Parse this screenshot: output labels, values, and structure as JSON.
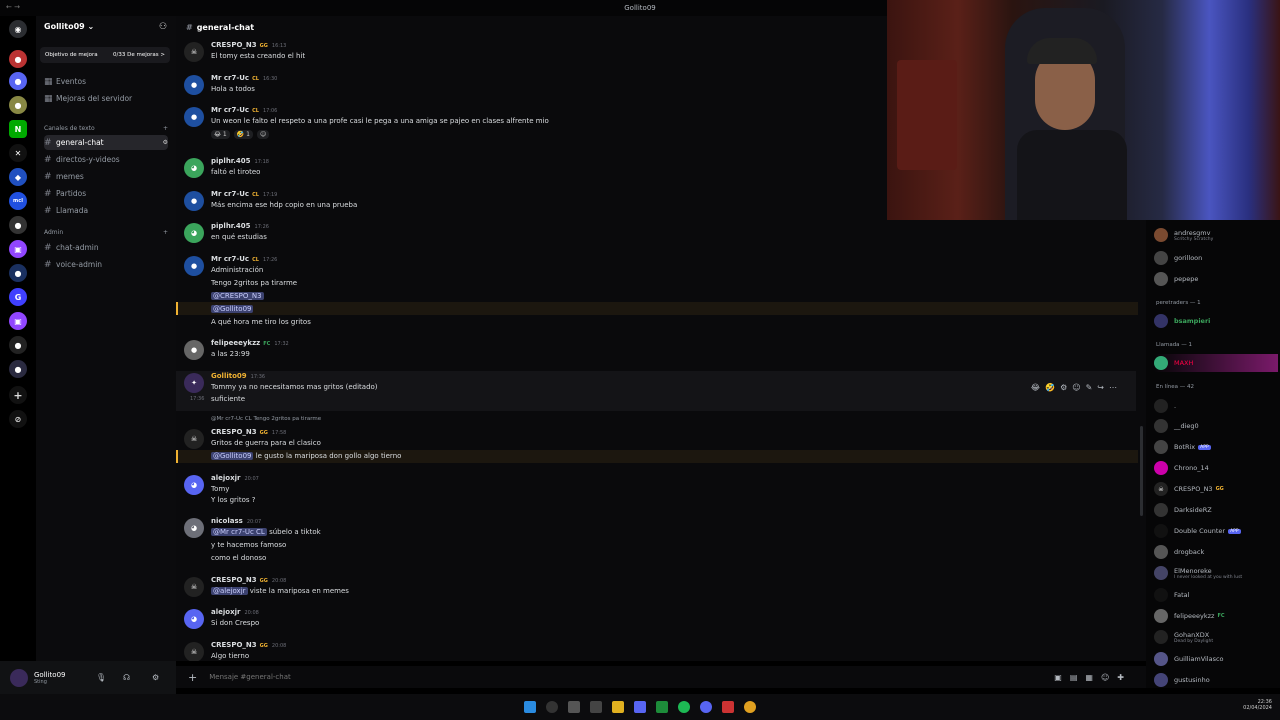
{
  "window": {
    "title": "Gollito09",
    "back": "← →"
  },
  "server": {
    "name": "Gollito09",
    "boost_label": "Objetivo de mejora",
    "boost_count": "0/33 De mejoras >"
  },
  "nav": [
    {
      "label": "Eventos"
    },
    {
      "label": "Mejoras del servidor"
    }
  ],
  "categories": {
    "text": "Canales de texto",
    "admin": "Admin"
  },
  "channels": [
    "general-chat",
    "directos-y-videos",
    "memes",
    "Partidos",
    "Llamada"
  ],
  "admin_channels": [
    "chat-admin",
    "voice-admin"
  ],
  "user": {
    "name": "Gollito09",
    "status": "Sting"
  },
  "chat": {
    "title": "general-chat",
    "placeholder": "Mensaje #general-chat"
  },
  "messages": [
    {
      "author": "CRESPO_N3",
      "badge": "GG",
      "time": "16:13",
      "color": "#ffffff",
      "lines": [
        "El tomy esta creando el hit"
      ]
    },
    {
      "author": "Mr cr7-Uc",
      "badge": "CL",
      "time": "16:30",
      "color": "#ffffff",
      "lines": [
        "Hola a todos"
      ]
    },
    {
      "author": "Mr cr7-Uc",
      "badge": "CL",
      "time": "17:06",
      "color": "#ffffff",
      "lines": [
        "Un weon le falto el respeto a una profe casi le pega a una amiga se pajeo en clases alfrente mio"
      ],
      "reactions": [
        "😂 1",
        "🤣 1",
        "☺"
      ]
    },
    {
      "author": "piplhr.405",
      "badge": "",
      "time": "17:18",
      "color": "#ffffff",
      "lines": [
        "faltó el tiroteo"
      ]
    },
    {
      "author": "Mr cr7-Uc",
      "badge": "CL",
      "time": "17:19",
      "color": "#ffffff",
      "lines": [
        "Más encima ese hdp copio en una prueba"
      ]
    },
    {
      "author": "piplhr.405",
      "badge": "",
      "time": "17:26",
      "color": "#ffffff",
      "lines": [
        "en qué estudias"
      ]
    },
    {
      "author": "Mr cr7-Uc",
      "badge": "CL",
      "time": "17:26",
      "color": "#ffffff",
      "lines": [
        "Administración",
        "Tengo 2gritos pa tirarme",
        "@CRESPO_N3",
        "@Gollito09",
        "A qué hora me tiro los gritos"
      ]
    },
    {
      "author": "felipeeeykzz",
      "badge": "FC",
      "time": "17:32",
      "color": "#ffffff",
      "lines": [
        "a las 23:99"
      ]
    },
    {
      "author": "Gollito09",
      "badge": "",
      "time": "17:36",
      "color": "#f0b232",
      "lines": [
        "Tommy ya no necesitamos mas gritos (editado)",
        "suficiente"
      ],
      "side_time": "17:36"
    },
    {
      "reply": "@Mr cr7-Uc CL Tengo 2gritos pa tirarme",
      "author": "CRESPO_N3",
      "badge": "GG",
      "time": "17:58",
      "color": "#ffffff",
      "lines": [
        "Gritos de guerra para el clasico",
        "@Gollito09 le gusto la mariposa don gollo algo tierno"
      ]
    },
    {
      "author": "alejoxjr",
      "badge": "",
      "time": "20:07",
      "color": "#ffffff",
      "lines": [
        "Tomy",
        "Y los gritos ?"
      ]
    },
    {
      "author": "nicolass",
      "badge": "",
      "time": "20:07",
      "color": "#ffffff",
      "lines": [
        "@Mr cr7-Uc CL súbelo a tiktok",
        "y te hacemos famoso",
        "como el donoso"
      ]
    },
    {
      "author": "CRESPO_N3",
      "badge": "GG",
      "time": "20:08",
      "color": "#ffffff",
      "lines": [
        "@alejoxjr viste la mariposa en memes"
      ]
    },
    {
      "author": "alejoxjr",
      "badge": "",
      "time": "20:08",
      "color": "#ffffff",
      "lines": [
        "Si don Crespo"
      ]
    },
    {
      "author": "CRESPO_N3",
      "badge": "GG",
      "time": "20:08",
      "color": "#ffffff",
      "lines": [
        "Algo tierno"
      ]
    }
  ],
  "members": {
    "top": [
      {
        "name": "andresgmv",
        "sub": "Scritchy Scratchy"
      },
      {
        "name": "gorilloon"
      },
      {
        "name": "pepepe"
      }
    ],
    "cat_streamers": "peretraders — 1",
    "streamer": {
      "name": "bsampieri"
    },
    "cat_call": "Llamada — 1",
    "caller": {
      "name": "MAXH"
    },
    "cat_online": "En línea — 42",
    "online": [
      {
        "name": "."
      },
      {
        "name": "__dieg0"
      },
      {
        "name": "BotRix",
        "tag": "APP"
      },
      {
        "name": "Chrono_14"
      },
      {
        "name": "CRESPO_N3",
        "tag2": "GG"
      },
      {
        "name": "DarksideRZ"
      },
      {
        "name": "Double Counter",
        "tag": "APP"
      },
      {
        "name": "drogback"
      },
      {
        "name": "ElMenoreke",
        "sub": "I never looked at you with lust"
      },
      {
        "name": "Fatal"
      },
      {
        "name": "felipeeeykzz",
        "tag2": "FC"
      },
      {
        "name": "GohanXDX",
        "sub": "Dead by Daylight"
      },
      {
        "name": "GuilliamVilasco"
      },
      {
        "name": "gustusinho"
      }
    ]
  },
  "clock": {
    "time": "22:36",
    "date": "02/04/2024"
  }
}
